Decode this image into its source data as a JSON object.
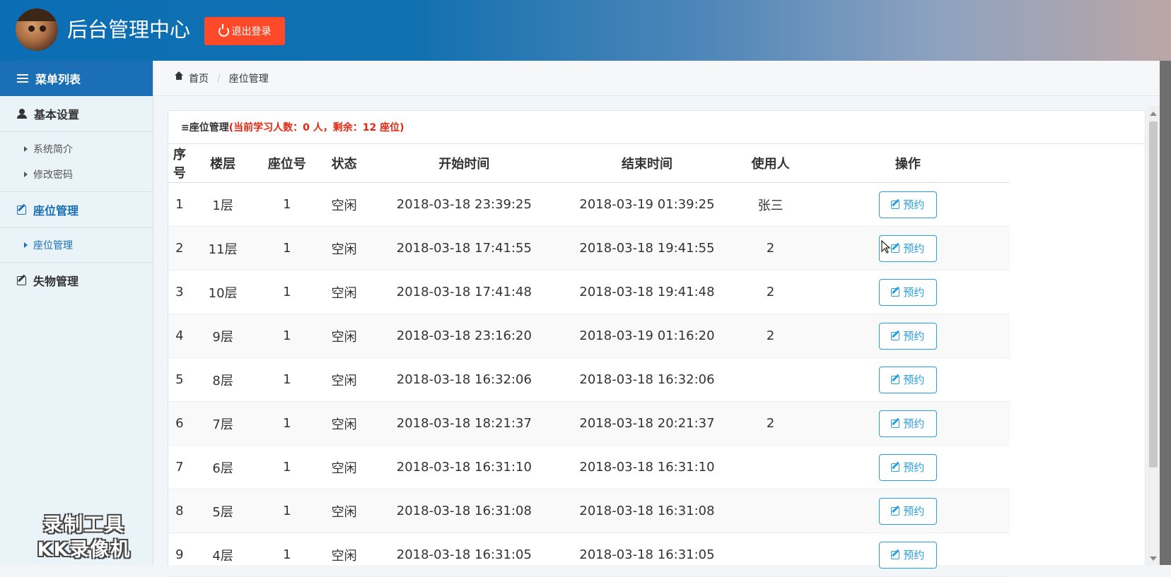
{
  "header": {
    "title": "后台管理中心",
    "logout_label": "退出登录"
  },
  "sidebar": {
    "menu_title": "菜单列表",
    "groups": [
      {
        "label": "基本设置",
        "items": [
          "系统简介",
          "修改密码"
        ]
      },
      {
        "label": "座位管理",
        "items": [
          "座位管理"
        ]
      },
      {
        "label": "失物管理",
        "items": []
      }
    ],
    "watermark_line1": "录制工具",
    "watermark_line2": "KK录像机"
  },
  "breadcrumb": {
    "home": "首页",
    "current": "座位管理"
  },
  "panel": {
    "title": "≡座位管理",
    "stats": "(当前学习人数：0 人，剩余：12 座位)"
  },
  "table": {
    "columns": [
      "序号",
      "楼层",
      "座位号",
      "状态",
      "开始时间",
      "结束时间",
      "使用人",
      "操作"
    ],
    "action_label": "预约",
    "rows": [
      {
        "no": "1",
        "floor": "1层",
        "seat": "1",
        "status": "空闲",
        "start": "2018-03-18 23:39:25",
        "end": "2018-03-19 01:39:25",
        "user": "张三"
      },
      {
        "no": "2",
        "floor": "11层",
        "seat": "1",
        "status": "空闲",
        "start": "2018-03-18 17:41:55",
        "end": "2018-03-18 19:41:55",
        "user": "2"
      },
      {
        "no": "3",
        "floor": "10层",
        "seat": "1",
        "status": "空闲",
        "start": "2018-03-18 17:41:48",
        "end": "2018-03-18 19:41:48",
        "user": "2"
      },
      {
        "no": "4",
        "floor": "9层",
        "seat": "1",
        "status": "空闲",
        "start": "2018-03-18 23:16:20",
        "end": "2018-03-19 01:16:20",
        "user": "2"
      },
      {
        "no": "5",
        "floor": "8层",
        "seat": "1",
        "status": "空闲",
        "start": "2018-03-18 16:32:06",
        "end": "2018-03-18 16:32:06",
        "user": ""
      },
      {
        "no": "6",
        "floor": "7层",
        "seat": "1",
        "status": "空闲",
        "start": "2018-03-18 18:21:37",
        "end": "2018-03-18 20:21:37",
        "user": "2"
      },
      {
        "no": "7",
        "floor": "6层",
        "seat": "1",
        "status": "空闲",
        "start": "2018-03-18 16:31:10",
        "end": "2018-03-18 16:31:10",
        "user": ""
      },
      {
        "no": "8",
        "floor": "5层",
        "seat": "1",
        "status": "空闲",
        "start": "2018-03-18 16:31:08",
        "end": "2018-03-18 16:31:08",
        "user": ""
      },
      {
        "no": "9",
        "floor": "4层",
        "seat": "1",
        "status": "空闲",
        "start": "2018-03-18 16:31:05",
        "end": "2018-03-18 16:31:05",
        "user": ""
      }
    ]
  }
}
